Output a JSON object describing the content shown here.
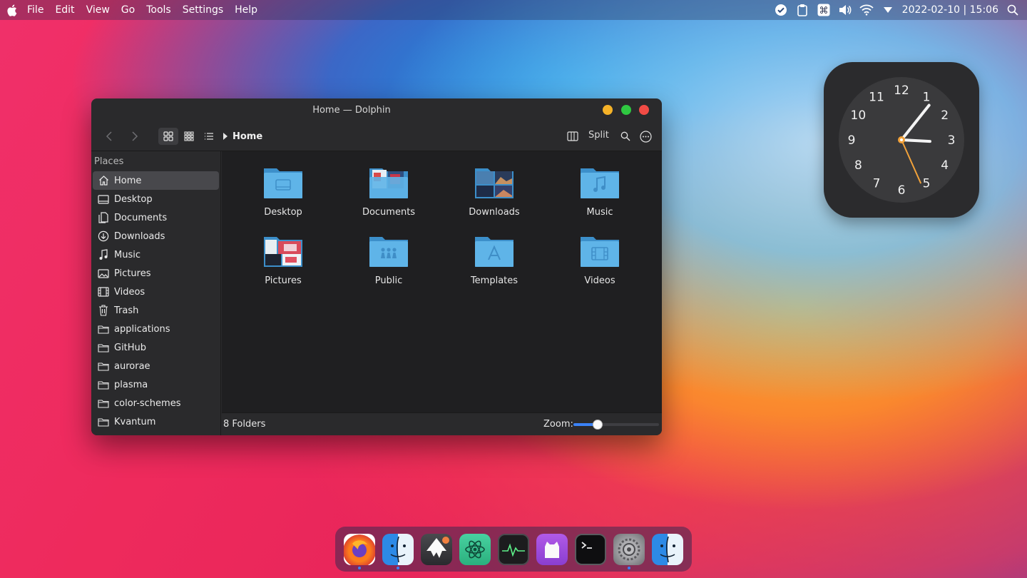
{
  "menubar": {
    "menus": [
      "File",
      "Edit",
      "View",
      "Go",
      "Tools",
      "Settings",
      "Help"
    ],
    "datetime": "2022-02-10 | 15:06",
    "tray_icons": [
      "check-circle-icon",
      "clipboard-icon",
      "command-key-icon",
      "volume-icon",
      "wifi-icon",
      "triangle-down-icon",
      "search-icon"
    ]
  },
  "window": {
    "title": "Home — Dolphin",
    "breadcrumb": "Home",
    "split_label": "Split",
    "places_title": "Places",
    "places": [
      {
        "label": "Home",
        "icon": "home-icon",
        "active": true
      },
      {
        "label": "Desktop",
        "icon": "desktop-icon"
      },
      {
        "label": "Documents",
        "icon": "documents-icon"
      },
      {
        "label": "Downloads",
        "icon": "downloads-icon"
      },
      {
        "label": "Music",
        "icon": "music-icon"
      },
      {
        "label": "Pictures",
        "icon": "pictures-icon"
      },
      {
        "label": "Videos",
        "icon": "videos-icon"
      },
      {
        "label": "Trash",
        "icon": "trash-icon"
      },
      {
        "label": "applications",
        "icon": "folder-icon"
      },
      {
        "label": "GitHub",
        "icon": "folder-icon"
      },
      {
        "label": "aurorae",
        "icon": "folder-icon"
      },
      {
        "label": "plasma",
        "icon": "folder-icon"
      },
      {
        "label": "color-schemes",
        "icon": "folder-icon"
      },
      {
        "label": "Kvantum",
        "icon": "folder-icon"
      }
    ],
    "folders": [
      {
        "label": "Desktop",
        "icon": "desktop-folder-icon"
      },
      {
        "label": "Documents",
        "icon": "documents-folder-icon"
      },
      {
        "label": "Downloads",
        "icon": "downloads-folder-icon"
      },
      {
        "label": "Music",
        "icon": "music-folder-icon"
      },
      {
        "label": "Pictures",
        "icon": "pictures-folder-icon"
      },
      {
        "label": "Public",
        "icon": "public-folder-icon"
      },
      {
        "label": "Templates",
        "icon": "templates-folder-icon"
      },
      {
        "label": "Videos",
        "icon": "videos-folder-icon"
      }
    ],
    "status_count": "8 Folders",
    "zoom_label": "Zoom:",
    "zoom_level": 0.28
  },
  "clock": {
    "numerals": [
      "12",
      "1",
      "2",
      "3",
      "4",
      "5",
      "6",
      "7",
      "8",
      "9",
      "10",
      "11"
    ],
    "hour": 15,
    "minute": 6,
    "second": 26
  },
  "dock": {
    "apps": [
      {
        "name": "firefox-icon",
        "running": true
      },
      {
        "name": "finder-icon",
        "running": true
      },
      {
        "name": "inkscape-icon",
        "running": false
      },
      {
        "name": "atom-icon",
        "running": false
      },
      {
        "name": "activity-monitor-icon",
        "running": false
      },
      {
        "name": "github-desktop-icon",
        "running": false
      },
      {
        "name": "terminal-icon",
        "running": false
      },
      {
        "name": "system-settings-icon",
        "running": true
      },
      {
        "name": "finder-icon",
        "running": false
      }
    ]
  },
  "colors": {
    "accent": "#3b82f6",
    "window_bg": "#2a2a2c",
    "content_bg": "#1f1f21",
    "folder_blue": "#5fb4e8"
  }
}
